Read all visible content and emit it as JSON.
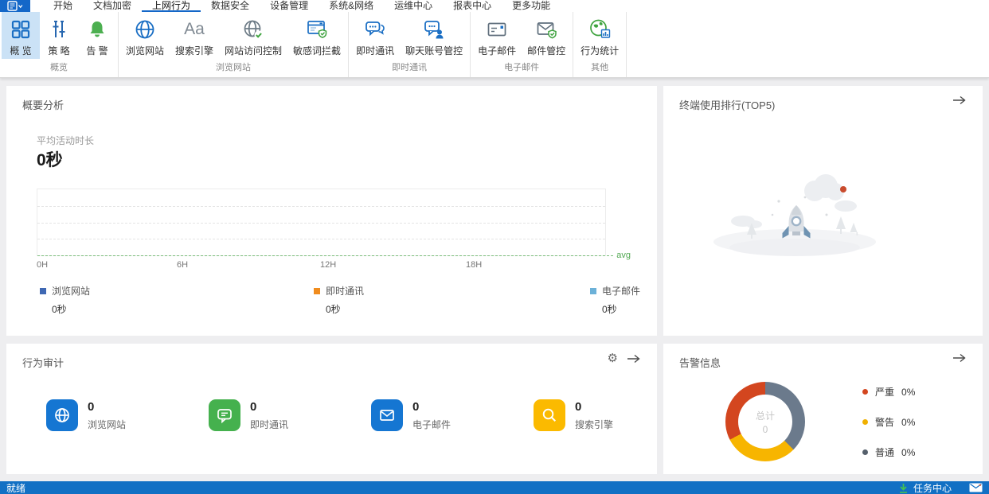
{
  "tabs": {
    "items": [
      {
        "label": "开始",
        "active": false
      },
      {
        "label": "文档加密",
        "active": false
      },
      {
        "label": "上网行为",
        "active": true
      },
      {
        "label": "数据安全",
        "active": false
      },
      {
        "label": "设备管理",
        "active": false
      },
      {
        "label": "系统&网络",
        "active": false
      },
      {
        "label": "运维中心",
        "active": false
      },
      {
        "label": "报表中心",
        "active": false
      },
      {
        "label": "更多功能",
        "active": false
      }
    ]
  },
  "ribbon": {
    "groups": [
      {
        "label": "概览",
        "items": [
          {
            "label": "概 览",
            "icon": "overview-grid-icon",
            "selected": true
          },
          {
            "label": "策 略",
            "icon": "policy-sliders-icon"
          },
          {
            "label": "告 警",
            "icon": "alert-bell-icon"
          }
        ]
      },
      {
        "label": "浏览网站",
        "items": [
          {
            "label": "浏览网站",
            "icon": "browse-globe-icon"
          },
          {
            "label": "搜索引擎",
            "icon": "search-engine-aa-icon",
            "glyph": "Aa"
          },
          {
            "label": "网站访问控制",
            "icon": "site-access-control-icon"
          },
          {
            "label": "敏感词拦截",
            "icon": "sensitive-word-block-icon"
          }
        ]
      },
      {
        "label": "即时通讯",
        "items": [
          {
            "label": "即时通讯",
            "icon": "im-chat-icon"
          },
          {
            "label": "聊天账号管控",
            "icon": "chat-account-control-icon"
          }
        ]
      },
      {
        "label": "电子邮件",
        "items": [
          {
            "label": "电子邮件",
            "icon": "email-icon"
          },
          {
            "label": "邮件管控",
            "icon": "mail-control-icon"
          }
        ]
      },
      {
        "label": "其他",
        "items": [
          {
            "label": "行为统计",
            "icon": "behavior-stats-icon"
          }
        ]
      }
    ]
  },
  "summary": {
    "title": "概要分析",
    "metric_label": "平均活动时长",
    "metric_value": "0秒",
    "chart": {
      "x_ticks": [
        "0H",
        "6H",
        "12H",
        "18H"
      ],
      "avg_label": "avg",
      "avg_color": "#52a852"
    },
    "legend": [
      {
        "label": "浏览网站",
        "value": "0秒",
        "color": "#3f68b3"
      },
      {
        "label": "即时通讯",
        "value": "0秒",
        "color": "#f08c1e"
      },
      {
        "label": "电子邮件",
        "value": "0秒",
        "color": "#6cb1d8"
      }
    ]
  },
  "top5": {
    "title": "终端使用排行(TOP5)"
  },
  "audit": {
    "title": "行为审计",
    "items": [
      {
        "value": "0",
        "label": "浏览网站",
        "color": "#1576d2",
        "icon": "globe-icon"
      },
      {
        "value": "0",
        "label": "即时通讯",
        "color": "#45b14e",
        "icon": "chat-icon"
      },
      {
        "value": "0",
        "label": "电子邮件",
        "color": "#1576d2",
        "icon": "mail-icon"
      },
      {
        "value": "0",
        "label": "搜索引擎",
        "color": "#fbba00",
        "icon": "search-icon"
      }
    ]
  },
  "alerts": {
    "title": "告警信息",
    "center_label": "总计",
    "center_value": "0",
    "legend": [
      {
        "label": "严重",
        "value": "0%",
        "color": "#d3461f"
      },
      {
        "label": "警告",
        "value": "0%",
        "color": "#f0b000"
      },
      {
        "label": "普通",
        "value": "0%",
        "color": "#55606c"
      }
    ]
  },
  "statusbar": {
    "status": "就绪",
    "task_center": "任务中心"
  },
  "icons": {
    "gear": "⚙"
  },
  "chart_data": [
    {
      "type": "line",
      "title": "平均活动时长",
      "x_ticks": [
        "0H",
        "6H",
        "12H",
        "18H"
      ],
      "x_range": [
        "0H",
        "24H"
      ],
      "ylim": [
        0,
        0
      ],
      "grid": "dashed-horizontal",
      "series": [
        {
          "name": "浏览网站",
          "value": 0,
          "unit": "秒"
        },
        {
          "name": "即时通讯",
          "value": 0,
          "unit": "秒"
        },
        {
          "name": "电子邮件",
          "value": 0,
          "unit": "秒"
        }
      ],
      "annotations": [
        {
          "label": "avg",
          "position": "bottom-right",
          "style": "green-dashed-line"
        }
      ],
      "legend_position": "bottom"
    },
    {
      "type": "pie",
      "title": "告警信息",
      "categories": [
        "严重",
        "警告",
        "普通"
      ],
      "values": [
        0,
        0,
        0
      ],
      "percent_labels": [
        "0%",
        "0%",
        "0%"
      ],
      "colors": [
        "#d3461f",
        "#f7b500",
        "#6b7a8c"
      ],
      "center": {
        "label": "总计",
        "value": "0"
      },
      "legend_position": "right",
      "style": "donut"
    }
  ]
}
